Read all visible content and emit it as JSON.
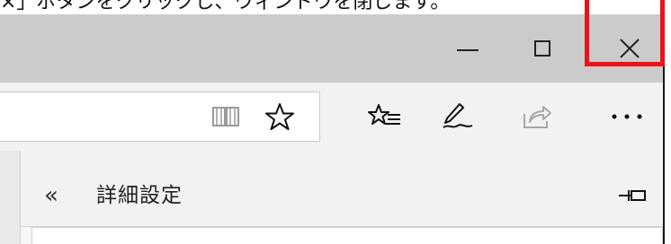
{
  "caption": "×」ボタンをクリックし、ウィンドウを閉じます。",
  "window_controls": {
    "minimize_icon": "minimize-icon",
    "maximize_icon": "maximize-icon",
    "close_icon": "close-icon",
    "highlight_color": "#e8141c"
  },
  "toolbar": {
    "address_value": "",
    "icons": [
      "reading-view-icon",
      "favorite-star-icon",
      "favorites-list-icon",
      "web-note-icon",
      "share-icon",
      "more-icon"
    ]
  },
  "settings_panel": {
    "back_glyph": "«",
    "title": "詳細設定",
    "pin_icon": "pin-icon"
  }
}
